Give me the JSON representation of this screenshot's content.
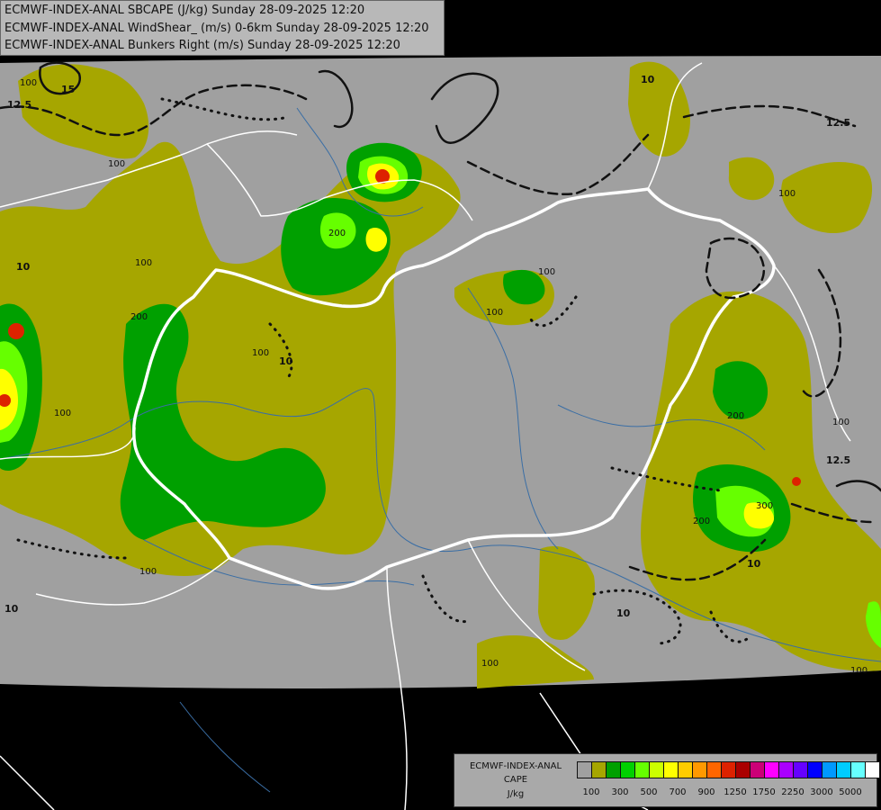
{
  "header": {
    "line1": "ECMWF-INDEX-ANAL SBCAPE (J/kg) Sunday 28-09-2025 12:20",
    "line2": "ECMWF-INDEX-ANAL WindShear_ (m/s) 0-6km Sunday 28-09-2025 12:20",
    "line3": "ECMWF-INDEX-ANAL Bunkers Right (m/s) Sunday 28-09-2025 12:20"
  },
  "legend": {
    "title1": "ECMWF-INDEX-ANAL",
    "title2": "CAPE",
    "unit": "J/kg",
    "swatches": [
      "#a0a0a0",
      "#a6a600",
      "#00a000",
      "#00d000",
      "#66ff00",
      "#ccff00",
      "#ffff00",
      "#ffcc00",
      "#ff9900",
      "#ff6600",
      "#dd2200",
      "#aa0000",
      "#cc0077",
      "#ff00ff",
      "#aa00ff",
      "#6600ff",
      "#0000ff",
      "#0099ff",
      "#00ccff",
      "#66ffff",
      "#ffffff"
    ],
    "ticks": [
      "100",
      "300",
      "500",
      "700",
      "900",
      "1250",
      "1750",
      "2250",
      "3000",
      "5000"
    ]
  },
  "map": {
    "colors": {
      "background": "#000000",
      "domain": "#a0a0a0",
      "cape_100": "#a6a600",
      "cape_200": "#00a000",
      "cape_300": "#00d000",
      "cape_400": "#66ff00",
      "cape_500": "#ffff00",
      "cape_900": "#dd2200",
      "border_country": "#ffffff",
      "river": "#3a6ea5",
      "contour": "#111111"
    },
    "contour_labels": [
      "12.5",
      "10",
      "100",
      "15",
      "10",
      "12.5",
      "100",
      "200",
      "100",
      "10",
      "100",
      "200",
      "100",
      "300",
      "200",
      "100",
      "10",
      "12.5",
      "100",
      "100",
      "200",
      "100",
      "10",
      "100",
      "100",
      "100",
      "10"
    ]
  }
}
